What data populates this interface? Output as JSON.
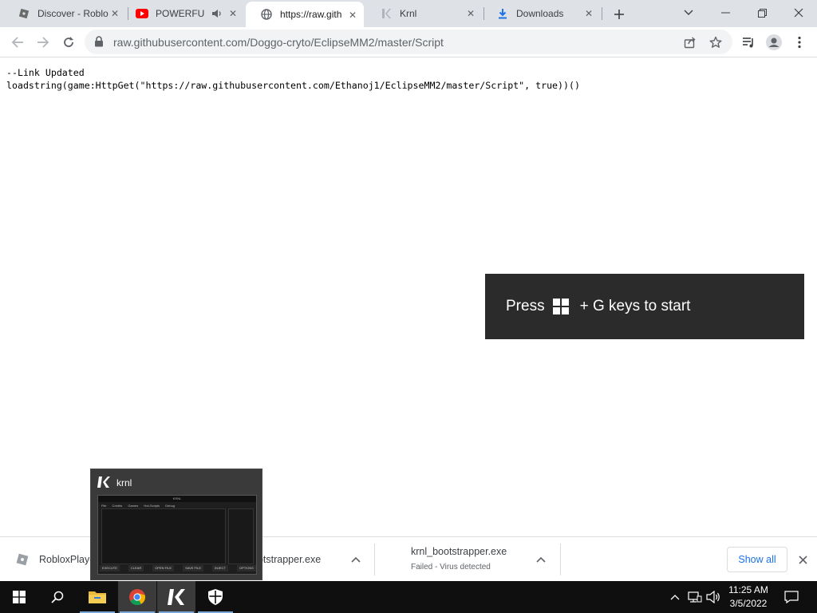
{
  "browser": {
    "tabs": [
      {
        "label": "Discover - Roblo",
        "favicon": "roblox-icon"
      },
      {
        "label": "POWERFUL",
        "favicon": "youtube-icon",
        "audio": true
      },
      {
        "label": "https://raw.gith",
        "favicon": "globe-icon",
        "active": true
      },
      {
        "label": "Krnl",
        "favicon": "krnl-icon"
      },
      {
        "label": "Downloads",
        "favicon": "download-icon"
      }
    ],
    "url": "raw.githubusercontent.com/Doggo-cryto/EclipseMM2/master/Script"
  },
  "page": {
    "lines": [
      "--Link Updated",
      "loadstring(game:HttpGet(\"https://raw.githubusercontent.com/Ethanoj1/EclipseMM2/master/Script\", true))()"
    ]
  },
  "gamebar": {
    "prefix": "Press",
    "suffix": "+ G keys to start"
  },
  "preview": {
    "title": "krnl",
    "thumb_title": "KRNL",
    "thumb_menu": "File Credits Games Hot-Scripts Debug",
    "thumb_buttons": [
      "EXECUTE",
      "CLEAR",
      "OPEN FILE",
      "SAVE FILE",
      "INJECT",
      "OPTIONS"
    ]
  },
  "downloads": {
    "items": [
      {
        "name_visible": "RobloxPlaye",
        "name_tail": "ootstrapper.exe"
      },
      {
        "name": "krnl_bootstrapper.exe",
        "status": "Failed - Virus detected"
      }
    ],
    "show_all": "Show all"
  },
  "taskbar": {
    "time": "11:25 AM",
    "date": "3/5/2022"
  },
  "colors": {
    "accent": "#1a73e8",
    "taskbar": "#0f0f0f",
    "gamebar": "#2b2b2b"
  }
}
